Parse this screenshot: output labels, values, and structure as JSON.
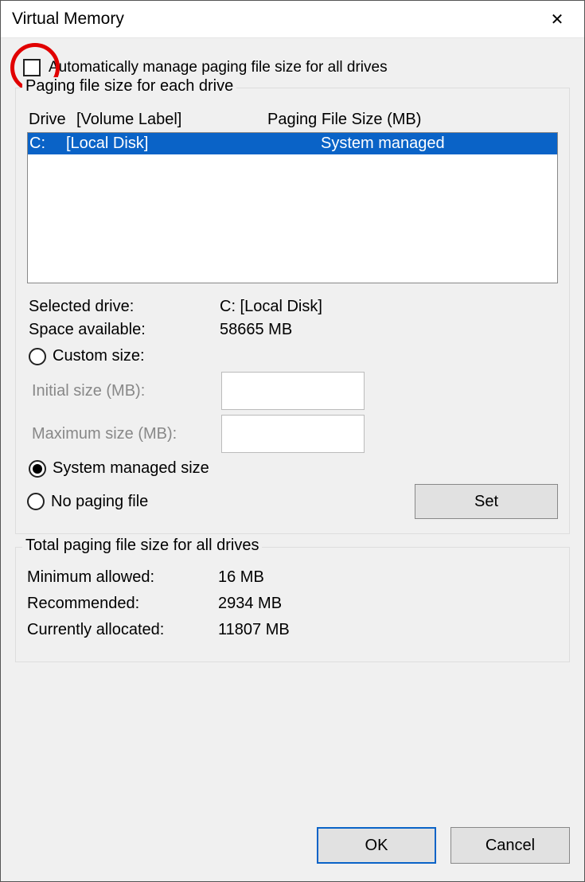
{
  "window": {
    "title": "Virtual Memory",
    "close": "✕"
  },
  "auto_manage": {
    "label": "Automatically manage paging file size for all drives",
    "checked": false
  },
  "group1": {
    "title": "Paging file size for each drive",
    "headers": {
      "drive": "Drive",
      "volume": "[Volume Label]",
      "paging": "Paging File Size (MB)"
    },
    "rows": [
      {
        "drive": "C:",
        "volume": "[Local Disk]",
        "paging": "System managed",
        "selected": true
      }
    ],
    "selected_drive_label": "Selected drive:",
    "selected_drive_value": "C:  [Local Disk]",
    "space_label": "Space available:",
    "space_value": "58665 MB",
    "custom_label": "Custom size:",
    "initial_label": "Initial size (MB):",
    "maximum_label": "Maximum size (MB):",
    "system_managed_label": "System managed size",
    "no_paging_label": "No paging file",
    "set_button": "Set",
    "size_mode": "system"
  },
  "group2": {
    "title": "Total paging file size for all drives",
    "min_label": "Minimum allowed:",
    "min_value": "16 MB",
    "rec_label": "Recommended:",
    "rec_value": "2934 MB",
    "cur_label": "Currently allocated:",
    "cur_value": "11807 MB"
  },
  "footer": {
    "ok": "OK",
    "cancel": "Cancel"
  }
}
